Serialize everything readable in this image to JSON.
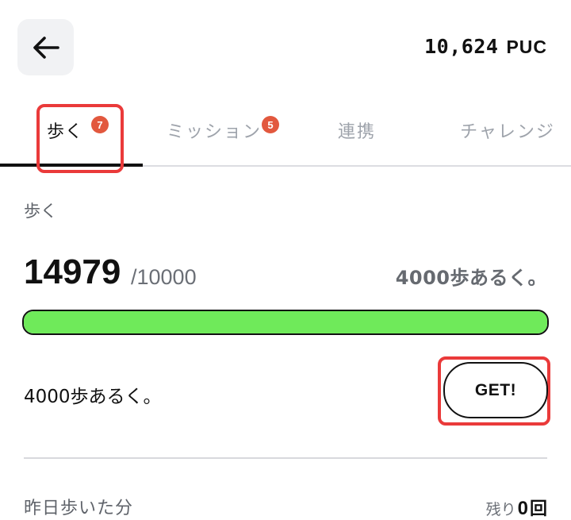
{
  "header": {
    "back_icon": "arrow-left-icon",
    "balance_amount": "10,624",
    "balance_unit": "PUC"
  },
  "tabs": [
    {
      "label": "歩く",
      "badge": "7",
      "active": true
    },
    {
      "label": "ミッション",
      "badge": "5",
      "active": false
    },
    {
      "label": "連携",
      "badge": "",
      "active": false
    },
    {
      "label": "チャレンジ",
      "badge": "",
      "active": false
    }
  ],
  "walk": {
    "section_label": "歩く",
    "steps_current": "14979",
    "steps_goal": "/10000",
    "steps_caption": "4000歩あるく。",
    "progress_fraction": 1.0,
    "mission_text": "4000歩あるく。",
    "get_label": "GET!"
  },
  "yesterday": {
    "label": "昨日歩いた分",
    "remaining_prefix": "残り",
    "remaining_count": "0",
    "remaining_suffix": "回"
  },
  "colors": {
    "progress_fill": "#6fea5a",
    "badge": "#e2583e",
    "highlight": "#ea3a3a"
  }
}
